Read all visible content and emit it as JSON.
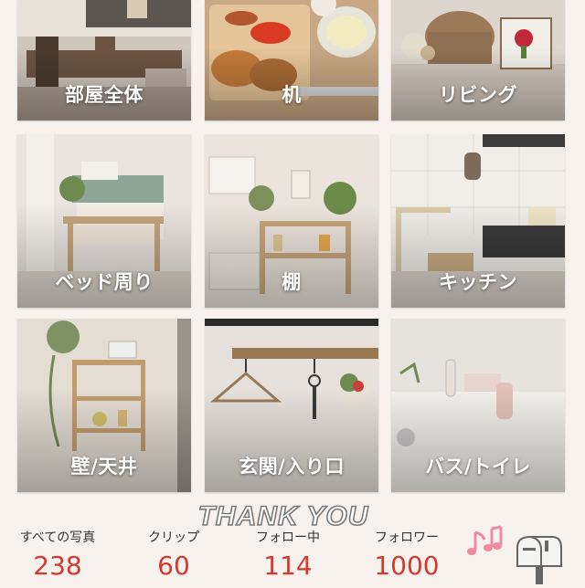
{
  "categories": [
    {
      "label": "部屋全体"
    },
    {
      "label": "机"
    },
    {
      "label": "リビング"
    },
    {
      "label": "ベッド周り"
    },
    {
      "label": "棚"
    },
    {
      "label": "キッチン"
    },
    {
      "label": "壁/天井"
    },
    {
      "label": "玄関/入り口"
    },
    {
      "label": "バス/トイレ"
    }
  ],
  "thanks_text": "THANK YOU",
  "stats": [
    {
      "label": "すべての写真",
      "value": "238"
    },
    {
      "label": "クリップ",
      "value": "60"
    },
    {
      "label": "フォロー中",
      "value": "114"
    },
    {
      "label": "フォロワー",
      "value": "1000"
    }
  ],
  "colors": {
    "accent": "#d23a2e",
    "background": "#f7f2ee",
    "note": "#f08aa0"
  },
  "icons": {
    "notes": "music-notes-icon",
    "mailbox": "mailbox-icon"
  }
}
